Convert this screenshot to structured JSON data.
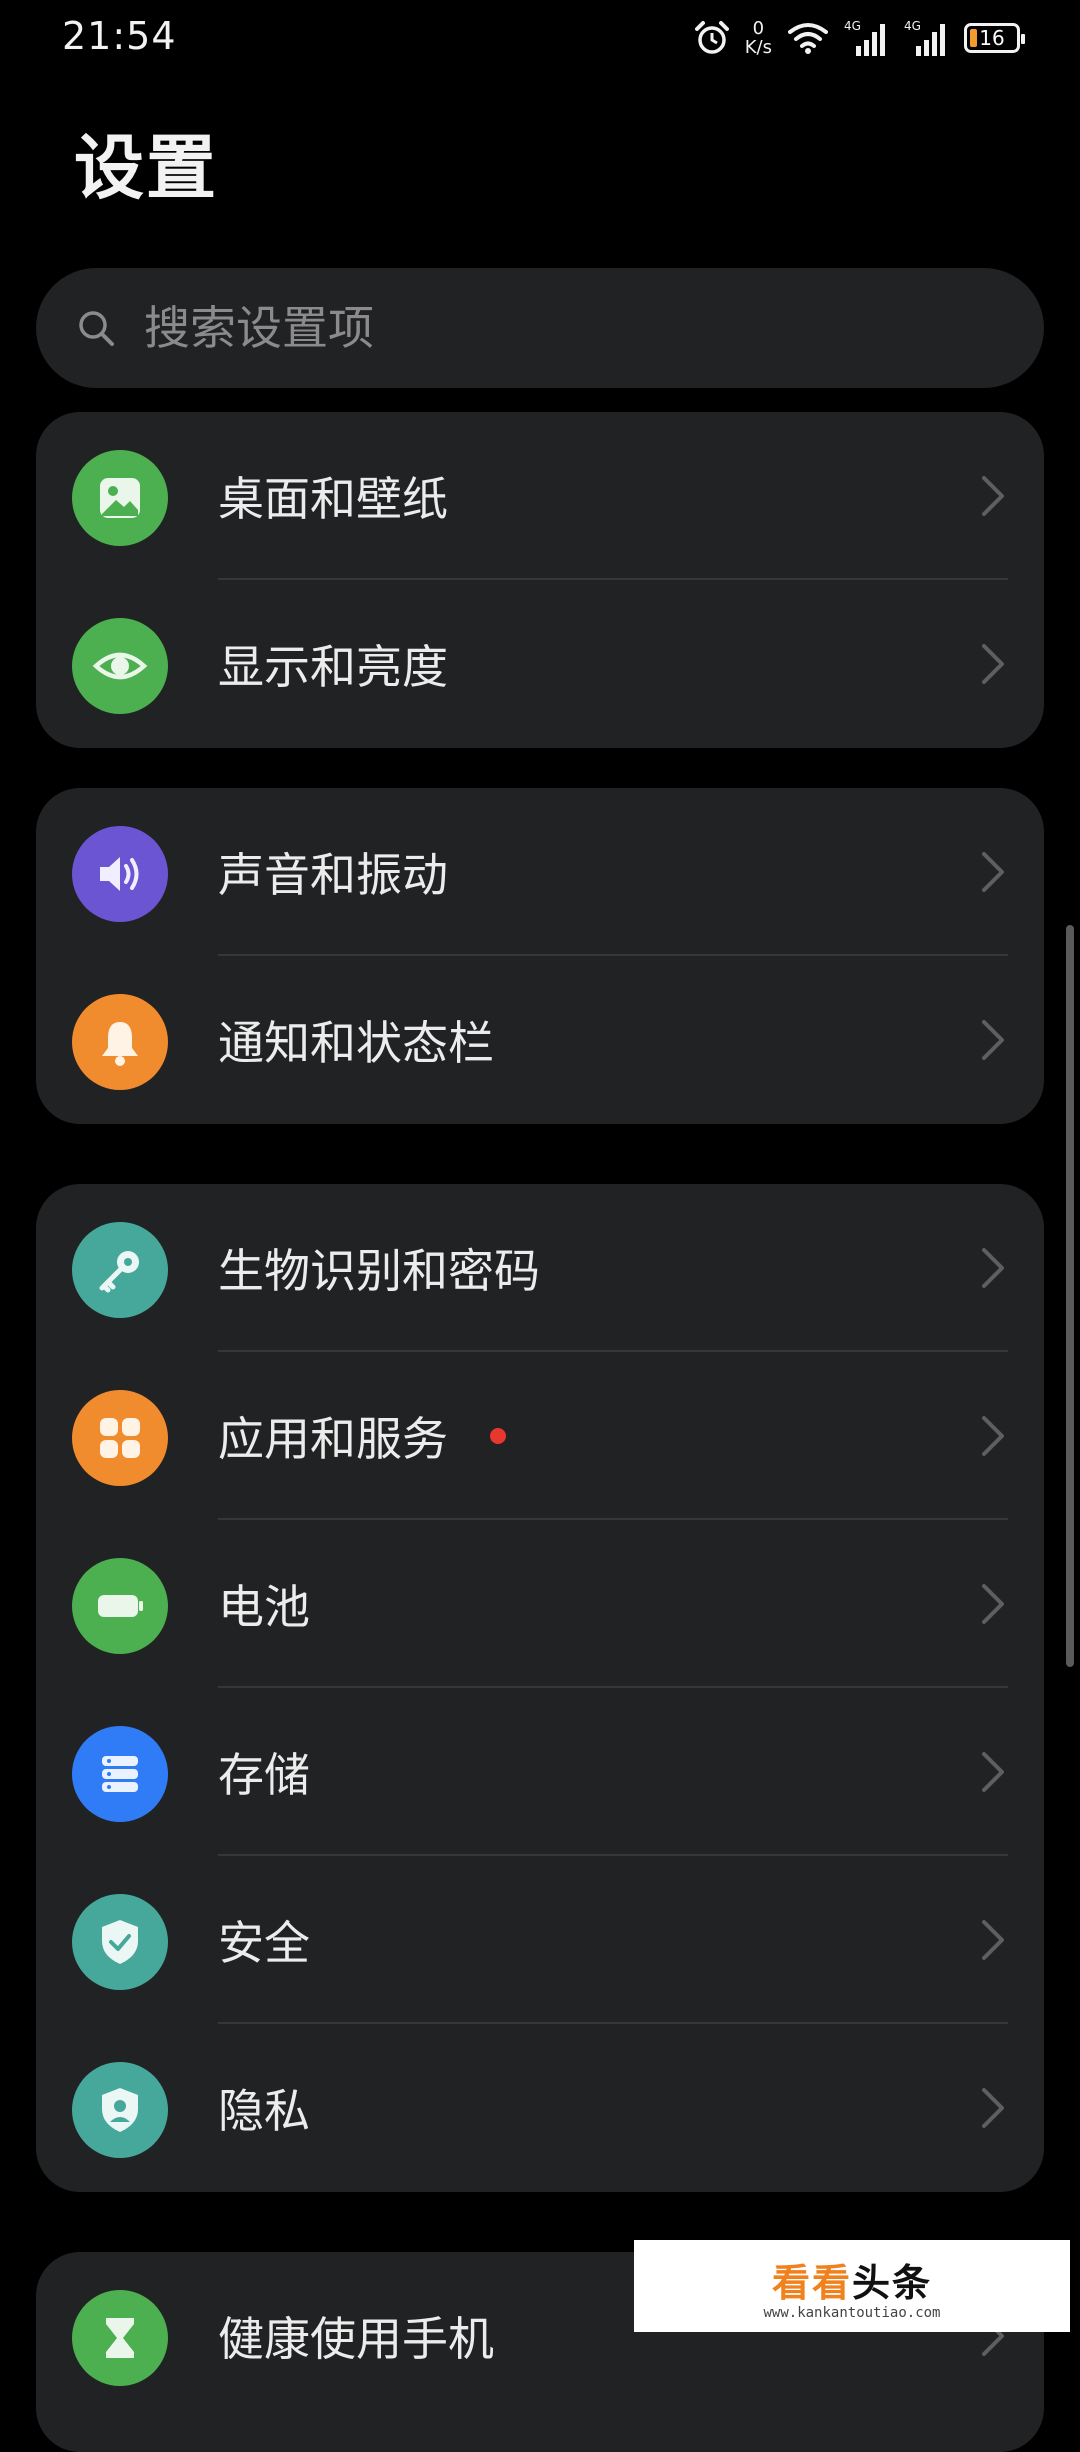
{
  "status_bar": {
    "time": "21:54",
    "net_speed_value": "0",
    "net_speed_unit": "K/s",
    "network_type": "4G",
    "network_type_2": "4G",
    "battery": "16",
    "battery_fill_percent": 16,
    "battery_fill_color": "#f39a2e"
  },
  "header": {
    "title": "设置"
  },
  "search": {
    "placeholder": "搜索设置项"
  },
  "colors": {
    "card_bg": "#212224",
    "green": "#4caf50",
    "purple": "#6b55d3",
    "orange": "#f08c2e",
    "teal": "#45a89a",
    "blue": "#2f7cf6",
    "badge_red": "#e8372f"
  },
  "groups": [
    {
      "items": [
        {
          "label": "桌面和壁纸",
          "icon": "wallpaper-icon"
        },
        {
          "label": "显示和亮度",
          "icon": "eye-icon"
        }
      ]
    },
    {
      "items": [
        {
          "label": "声音和振动",
          "icon": "speaker-icon"
        },
        {
          "label": "通知和状态栏",
          "icon": "bell-icon"
        }
      ]
    },
    {
      "items": [
        {
          "label": "生物识别和密码",
          "icon": "key-icon"
        },
        {
          "label": "应用和服务",
          "icon": "apps-icon",
          "badge": true
        },
        {
          "label": "电池",
          "icon": "battery-icon"
        },
        {
          "label": "存储",
          "icon": "storage-icon"
        },
        {
          "label": "安全",
          "icon": "shield-check-icon"
        },
        {
          "label": "隐私",
          "icon": "privacy-shield-icon"
        }
      ]
    },
    {
      "items": [
        {
          "label": "健康使用手机",
          "icon": "hourglass-icon"
        }
      ]
    }
  ],
  "watermark": {
    "main_a": "看看",
    "main_b": "头条",
    "sub": "www.kankantoutiao.com"
  }
}
